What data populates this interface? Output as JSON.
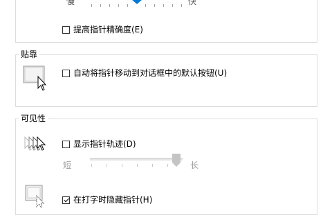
{
  "speed": {
    "slow_label": "慢",
    "fast_label": "快",
    "enhance_precision": {
      "label": "提高指针精确度(E)",
      "checked": false
    }
  },
  "snap_to": {
    "title": "贴靠",
    "auto_move": {
      "label": "自动将指针移动到对话框中的默认按钮(U)",
      "checked": false
    }
  },
  "visibility": {
    "title": "可见性",
    "trails": {
      "label": "显示指针轨迹(D)",
      "checked": false
    },
    "trail_short": "短",
    "trail_long": "长",
    "hide_typing": {
      "label": "在打字时隐藏指针(H)",
      "checked": true
    }
  },
  "colors": {
    "accent": "#0078d7",
    "border": "#dcdcdc"
  }
}
